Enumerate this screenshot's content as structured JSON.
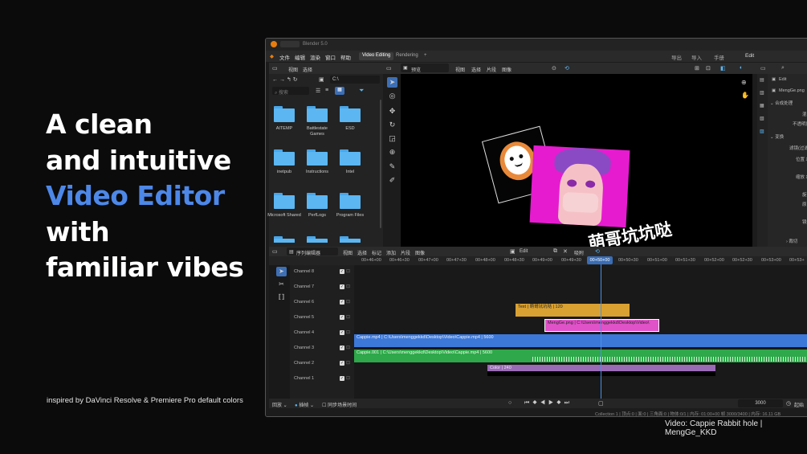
{
  "headline": {
    "line1": "A clean",
    "line2": "and intuitive",
    "line3": "Video Editor",
    "line4": "with",
    "line5": "familiar vibes"
  },
  "inspired_text": "inspired by DaVinci Resolve & Premiere Pro default colors",
  "credit_text": "Video: Cappie Rabbit hole | MengGe_KKD",
  "colors": {
    "accent": "#4d88e8",
    "video_strip": "#3c78d8",
    "audio_strip": "#2ea84a",
    "text_strip": "#d9a132",
    "image_strip": "#e052c8",
    "color_strip": "#9a6bb5"
  },
  "window": {
    "title": "Blender 5.0",
    "menus": [
      "文件",
      "编辑",
      "渲染",
      "窗口",
      "帮助"
    ],
    "workspaces": [
      "Video Editing",
      "Rendering",
      "+"
    ],
    "right_buttons": [
      "导出",
      "导入",
      "手册",
      "Edit"
    ]
  },
  "file_browser": {
    "header": [
      "视图",
      "选择"
    ],
    "path": "C:\\",
    "search_placeholder": "搜索",
    "folders": [
      "AITEMP",
      "Battlestate Games",
      "ESD",
      "inetpub",
      "Instructions",
      "Intel",
      "Microsoft Shared",
      "PerfLogs",
      "Program Files"
    ]
  },
  "preview": {
    "header": [
      "预览",
      "视图",
      "选择",
      "片段",
      "图像"
    ],
    "overlay_text": "萌哥坑坑哒"
  },
  "properties": {
    "edit_label": "Edit",
    "strip_name": "MengGe.png",
    "sections": [
      {
        "label": "合成处理",
        "rows": [
          {
            "label": "混合"
          },
          {
            "label": "不透明度"
          }
        ]
      },
      {
        "label": "变换",
        "rows": [
          {
            "label": "滤镜(过滤)"
          },
          {
            "label": "位置 X"
          },
          {
            "label": "Y"
          },
          {
            "label": "缩放 X"
          },
          {
            "label": "Y"
          },
          {
            "label": "旋转"
          },
          {
            "label": "原点"
          },
          {
            "label": "镜像"
          }
        ]
      },
      {
        "label": "裁切",
        "rows": []
      }
    ]
  },
  "sequencer": {
    "editor_name": "序列编辑器",
    "menus": [
      "视图",
      "选择",
      "标记",
      "添加",
      "片段",
      "图像"
    ],
    "mode": "Edit",
    "snap": "吸附",
    "timecodes": [
      "00+46+00",
      "00+46+30",
      "00+47+00",
      "00+47+30",
      "00+48+00",
      "00+48+30",
      "00+49+00",
      "00+49+30",
      "00+50+00",
      "00+50+30",
      "00+51+00",
      "00+51+30",
      "00+52+00",
      "00+52+30",
      "00+53+00",
      "00+53+"
    ],
    "current_time": "00+50+00",
    "channels": [
      "Channel 8",
      "Channel 7",
      "Channel 6",
      "Channel 5",
      "Channel 4",
      "Channel 3",
      "Channel 2",
      "Channel 1"
    ],
    "strips": [
      {
        "type": "text",
        "label": "Text | 萌哥坑坑哒 | 120",
        "channel": 5
      },
      {
        "type": "image",
        "label": "MengGe.png | C:\\Users\\menggekkd\\Desktop\\Video\\",
        "channel": 4
      },
      {
        "type": "movie",
        "label": "Cappie.mp4 | C:\\Users\\menggekkd\\Desktop\\Video\\Cappie.mp4 | 5600",
        "channel": 3
      },
      {
        "type": "sound",
        "label": "Cappie.001 | C:\\Users\\menggekkd\\Desktop\\Video\\Cappie.mp4 | 5600",
        "channel": 2
      },
      {
        "type": "color",
        "label": "Color | 240",
        "channel": 1
      }
    ]
  },
  "footer": {
    "playback": "回放",
    "keying": "插帧",
    "sync_label": "同步场景时间",
    "frame_value": "3000",
    "start_label": "起始"
  },
  "status_bar": "Collection 1 | 顶点:0 | 面:0 | 三角面:0 | 物体:0/1 | 内存: 01:00+00 帧 3000/3400 | 内存: 16.11 GB"
}
